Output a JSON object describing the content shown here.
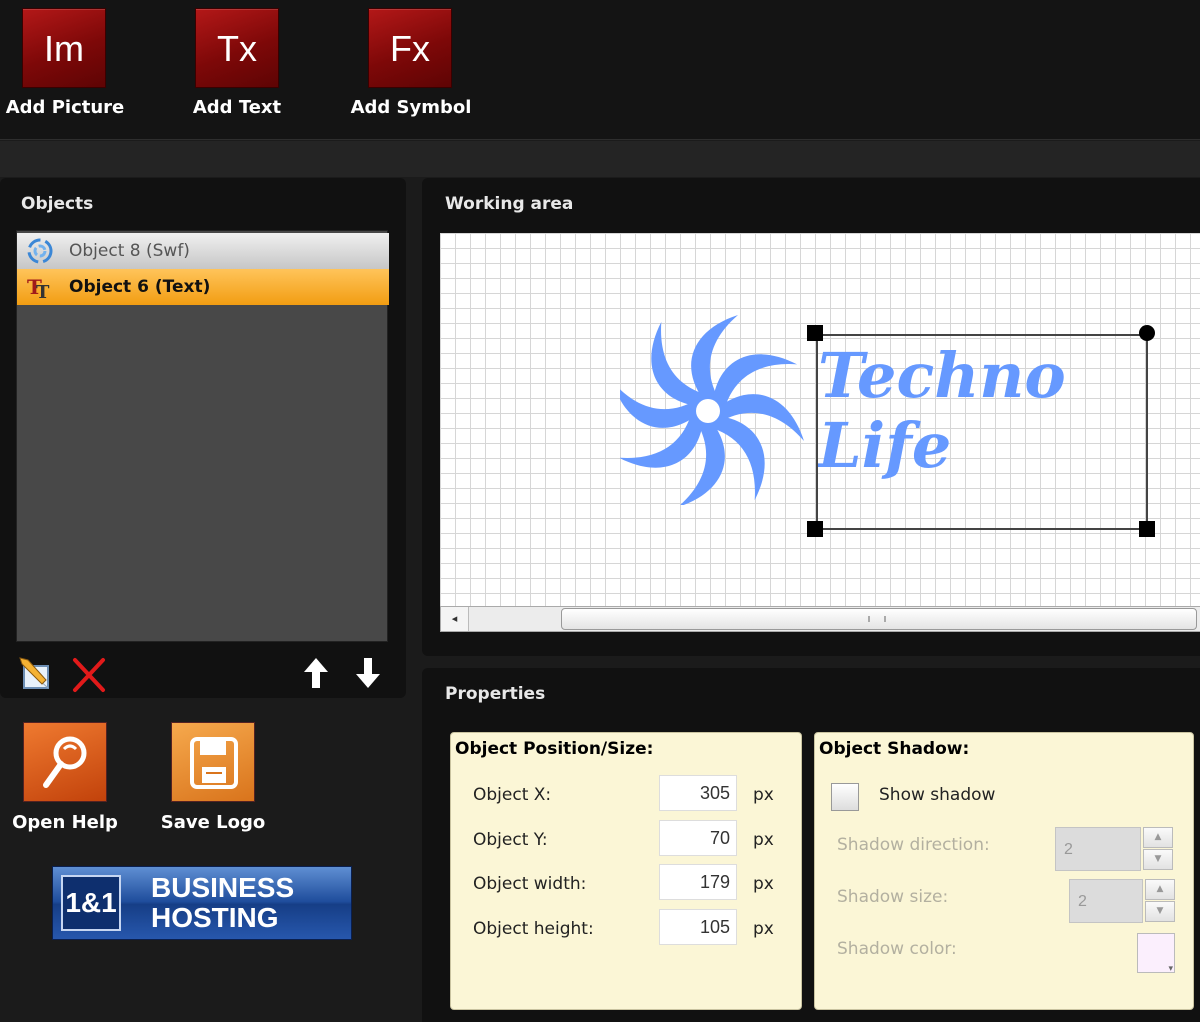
{
  "toolbar": {
    "buttons": [
      {
        "glyph": "Im",
        "label": "Add Picture"
      },
      {
        "glyph": "Tx",
        "label": "Add Text"
      },
      {
        "glyph": "Fx",
        "label": "Add Symbol"
      }
    ]
  },
  "objects_panel": {
    "title": "Objects",
    "items": [
      {
        "label": "Object 8 (Swf)",
        "icon": "swf-swirl-icon",
        "selected": false
      },
      {
        "label": "Object 6 (Text)",
        "icon": "text-tt-icon",
        "selected": true
      }
    ],
    "tools": [
      "edit-object-icon",
      "delete-x-icon",
      "move-up-arrow-icon",
      "move-down-arrow-icon"
    ]
  },
  "side_buttons": [
    {
      "label": "Open Help",
      "icon": "magnifier-help-icon"
    },
    {
      "label": "Save Logo",
      "icon": "floppy-save-icon"
    }
  ],
  "banner": {
    "logo": "1&1",
    "line1": "BUSINESS",
    "line2": "HOSTING"
  },
  "working_area": {
    "title": "Working area",
    "logo_text_line1": "Techno",
    "logo_text_line2": "Life",
    "logo_color": "#6699ff"
  },
  "properties": {
    "title": "Properties",
    "position_size": {
      "header": "Object Position/Size:",
      "rows": [
        {
          "label": "Object X:",
          "value": "305",
          "unit": "px"
        },
        {
          "label": "Object Y:",
          "value": "70",
          "unit": "px"
        },
        {
          "label": "Object width:",
          "value": "179",
          "unit": "px"
        },
        {
          "label": "Object height:",
          "value": "105",
          "unit": "px"
        }
      ]
    },
    "shadow": {
      "header": "Object Shadow:",
      "show_label": "Show shadow",
      "show_checked": false,
      "direction_label": "Shadow direction:",
      "direction_value": "2",
      "size_label": "Shadow size:",
      "size_value": "2",
      "color_label": "Shadow color:",
      "color_value": "#fbeffd"
    }
  },
  "colors": {
    "accent_red": "#8b0b0b",
    "selection_orange": "#f6a623",
    "properties_bg": "#fbf6d6"
  }
}
